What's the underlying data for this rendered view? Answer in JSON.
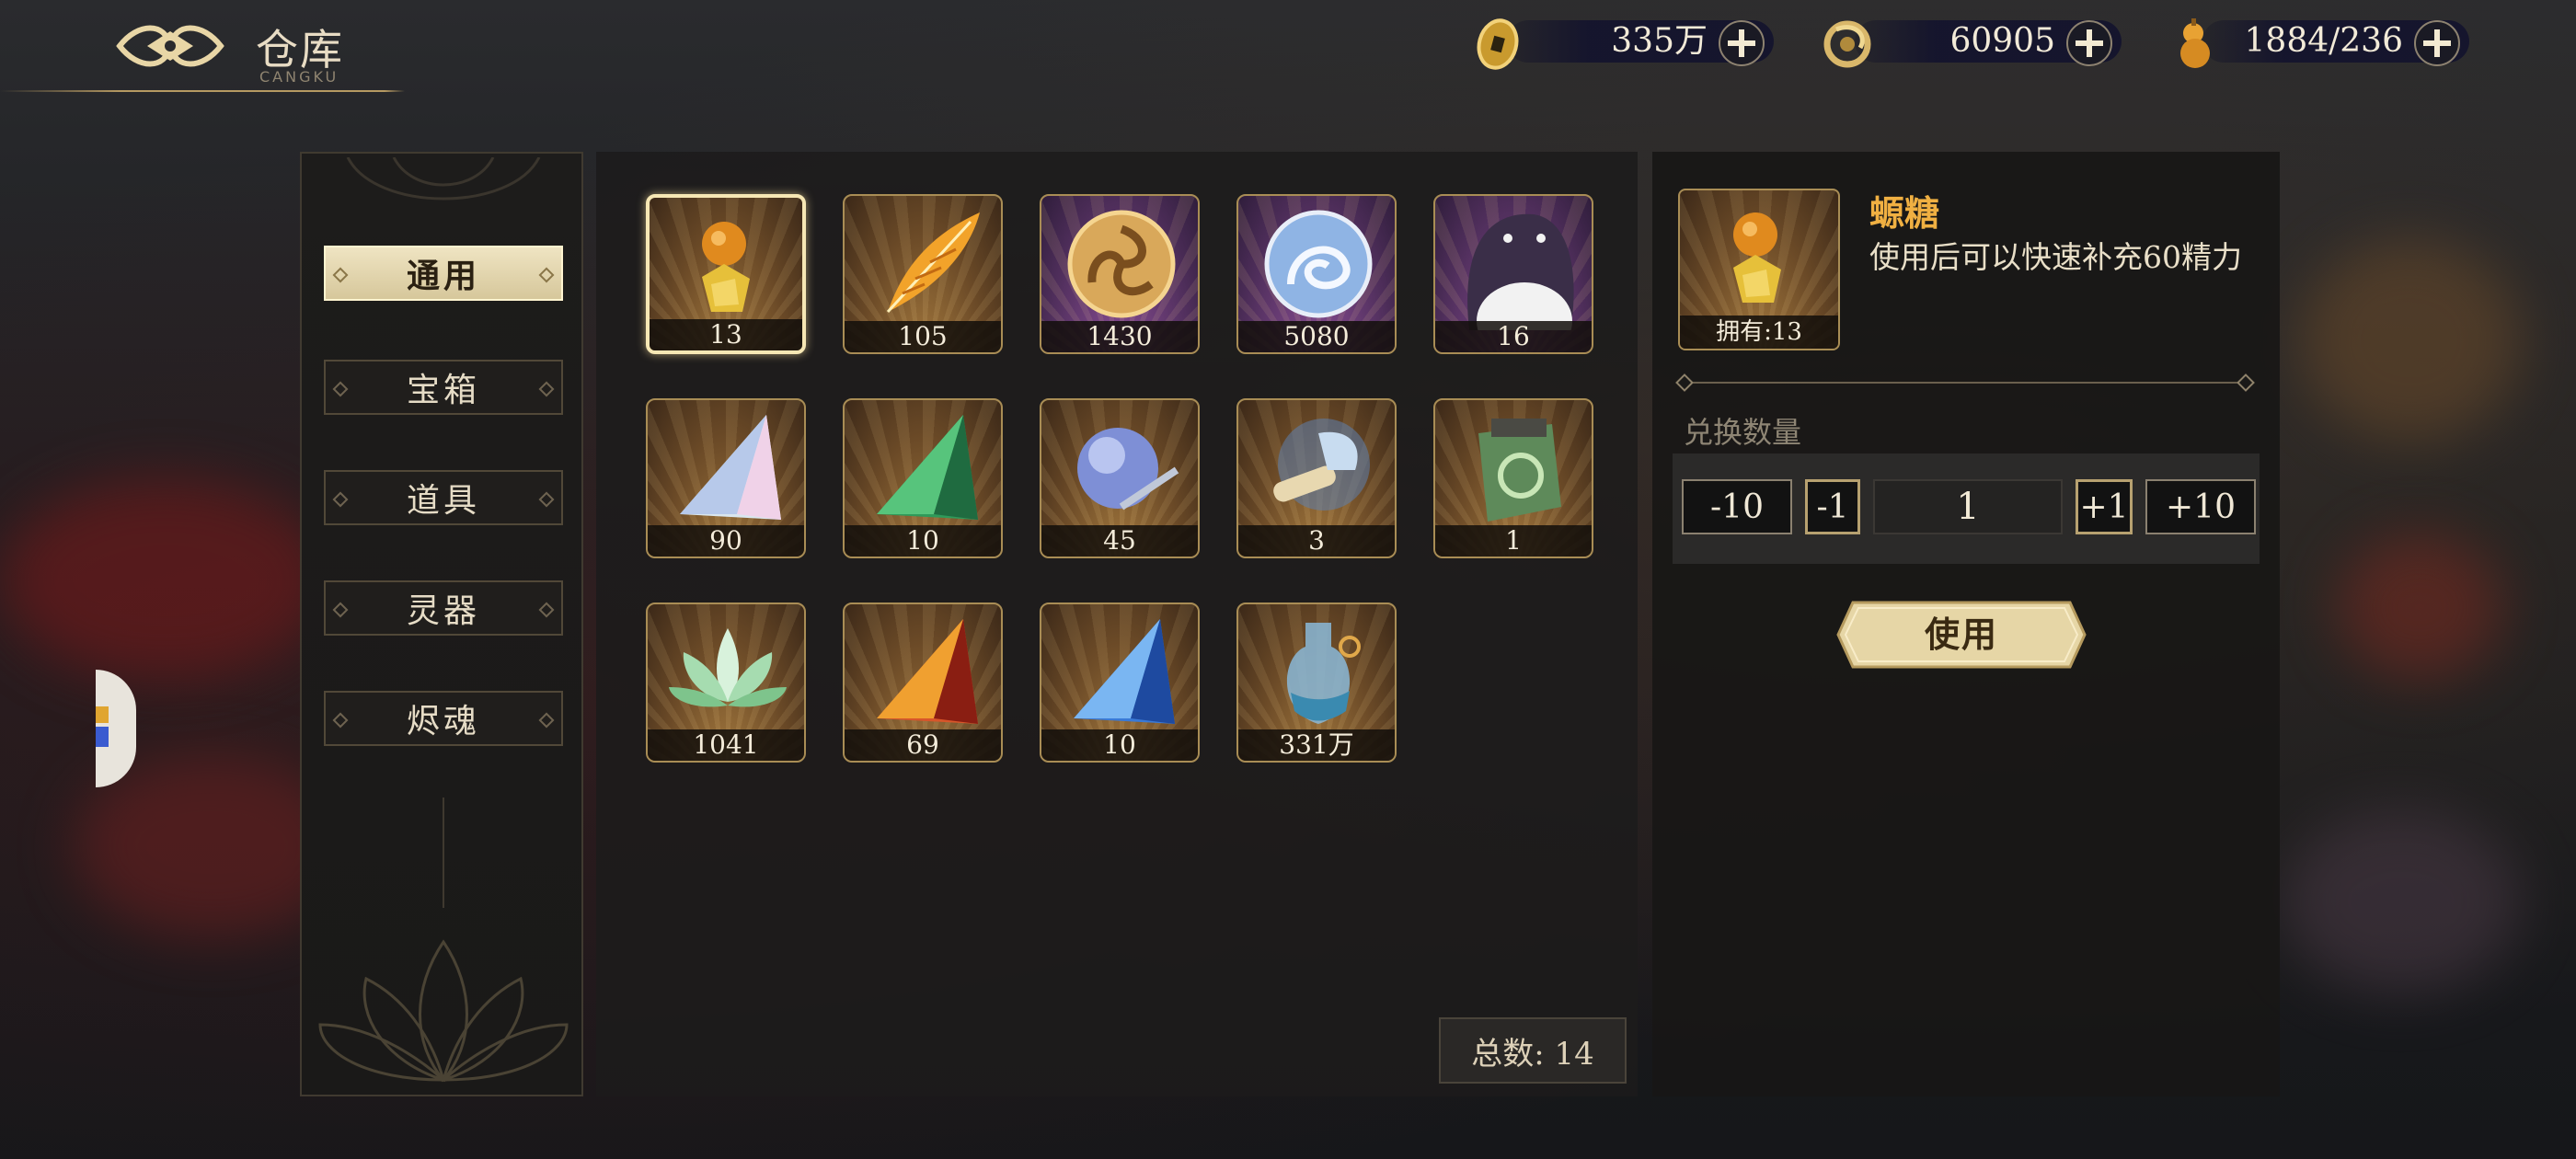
{
  "header": {
    "title": "仓库",
    "subtitle": "CANGKU",
    "resources": [
      {
        "name": "coin",
        "icon": "gold-coin-icon",
        "value": "335万"
      },
      {
        "name": "jade",
        "icon": "dragon-jade-icon",
        "value": "60905"
      },
      {
        "name": "stamina",
        "icon": "gourd-icon",
        "value": "1884/236"
      }
    ]
  },
  "tabs": [
    {
      "label": "通用",
      "active": true
    },
    {
      "label": "宝箱",
      "active": false
    },
    {
      "label": "道具",
      "active": false
    },
    {
      "label": "灵器",
      "active": false
    },
    {
      "label": "烬魂",
      "active": false
    }
  ],
  "items": [
    {
      "icon": "gourd-candy-icon",
      "count": "13",
      "rarity": "gold",
      "selected": true
    },
    {
      "icon": "golden-feather-icon",
      "count": "105",
      "rarity": "gold"
    },
    {
      "icon": "triskelion-medallion-icon",
      "count": "1430",
      "rarity": "purple"
    },
    {
      "icon": "beast-medallion-icon",
      "count": "5080",
      "rarity": "purple"
    },
    {
      "icon": "ghost-creature-icon",
      "count": "16",
      "rarity": "purple"
    },
    {
      "icon": "white-crystal-icon",
      "count": "90",
      "rarity": "gold"
    },
    {
      "icon": "green-crystal-icon",
      "count": "10",
      "rarity": "gold"
    },
    {
      "icon": "crystal-orb-icon",
      "count": "45",
      "rarity": "gold"
    },
    {
      "icon": "scroll-teapot-icon",
      "count": "3",
      "rarity": "gold"
    },
    {
      "icon": "jade-token-icon",
      "count": "1",
      "rarity": "gold"
    },
    {
      "icon": "lotus-icon",
      "count": "1041",
      "rarity": "gold"
    },
    {
      "icon": "red-crystal-icon",
      "count": "69",
      "rarity": "gold"
    },
    {
      "icon": "blue-crystal-icon",
      "count": "10",
      "rarity": "gold"
    },
    {
      "icon": "potion-bottle-icon",
      "count": "331万",
      "rarity": "gold"
    }
  ],
  "total": "总数: 14",
  "detail": {
    "name": "螈糖",
    "description": "使用后可以快速补充60精力",
    "owned": "拥有:13",
    "exchange_label": "兑换数量",
    "quantity": "1",
    "buttons": {
      "minus10": "-10",
      "minus1": "-1",
      "plus1": "+1",
      "plus10": "+10"
    },
    "use_label": "使用"
  },
  "colors": {
    "accent_gold": "#f0b042",
    "panel": "#1c1b1b",
    "tab_active": "#e6dab4"
  }
}
